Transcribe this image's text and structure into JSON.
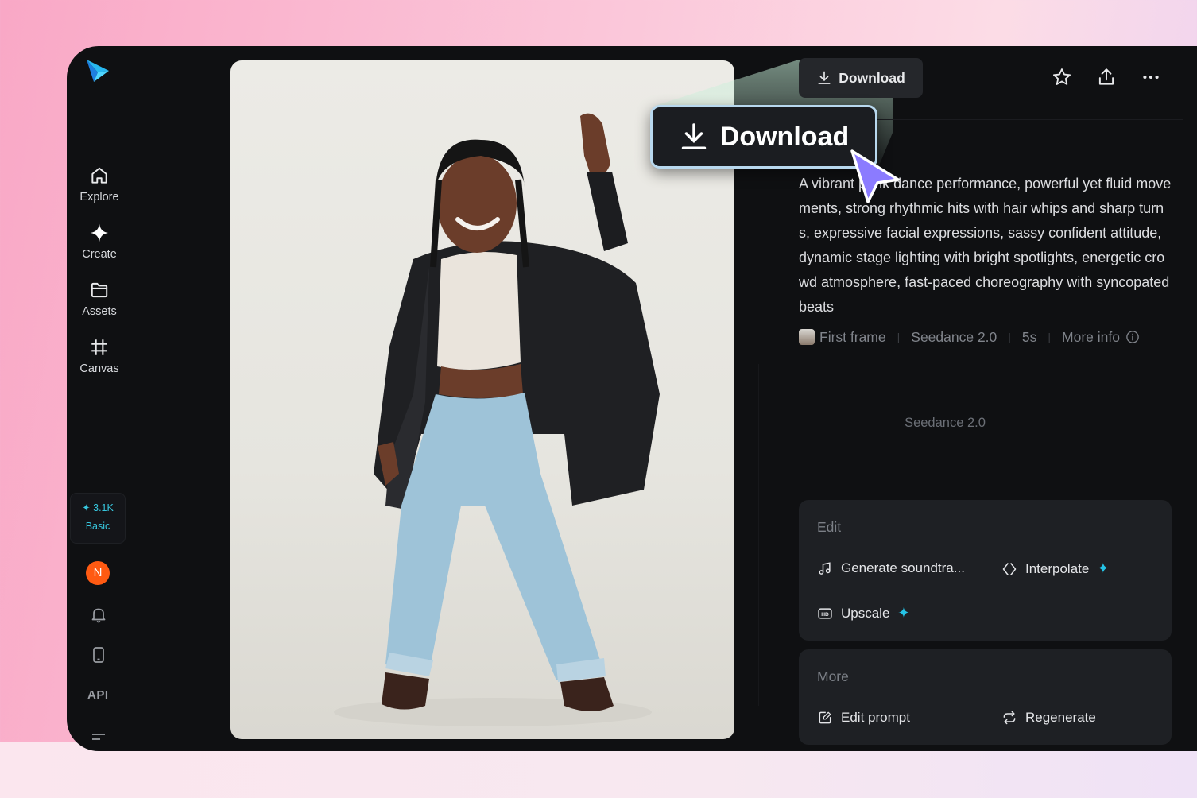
{
  "sidebar": {
    "items": [
      {
        "label": "Explore",
        "icon": "home-icon"
      },
      {
        "label": "Create",
        "icon": "sparkle-icon"
      },
      {
        "label": "Assets",
        "icon": "folder-icon"
      },
      {
        "label": "Canvas",
        "icon": "canvas-icon"
      }
    ],
    "credits": "3.1K",
    "plan": "Basic",
    "avatar_initial": "N",
    "api_label": "API"
  },
  "header": {
    "download_label": "Download"
  },
  "callout": {
    "download_label": "Download"
  },
  "prompt": {
    "text": "A vibrant punk dance performance, powerful yet fluid movements, strong rhythmic hits with hair whips and sharp turns, expressive facial expressions, sassy confident attitude, dynamic stage lighting with bright spotlights, energetic crowd atmosphere, fast-paced choreography with syncopated beats"
  },
  "meta": {
    "first_frame": "First frame",
    "model": "Seedance 2.0",
    "duration": "5s",
    "more_info": "More info"
  },
  "model_center": "Seedance 2.0",
  "edit_card": {
    "title": "Edit",
    "actions": [
      {
        "label": "Generate soundtra...",
        "icon": "music-note-icon"
      },
      {
        "label": "Interpolate",
        "icon": "interpolate-icon"
      },
      {
        "label": "Upscale",
        "icon": "hd-icon"
      }
    ]
  },
  "more_card": {
    "title": "More",
    "actions": [
      {
        "label": "Edit prompt",
        "icon": "edit-prompt-icon"
      },
      {
        "label": "Regenerate",
        "icon": "regenerate-icon"
      }
    ]
  },
  "colors": {
    "accent": "#25c3e6",
    "avatar": "#ff5a12",
    "app_bg": "#0f1012",
    "card_bg": "#1e2024"
  }
}
